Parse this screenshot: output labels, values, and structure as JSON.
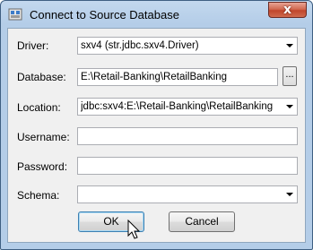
{
  "window": {
    "title": "Connect to Source Database"
  },
  "icons": {
    "app": "database-connect-icon",
    "close": "close-icon",
    "dropdown": "chevron-down-icon",
    "cursor": "mouse-pointer-icon"
  },
  "form": {
    "driver": {
      "label": "Driver:",
      "value": "sxv4  (str.jdbc.sxv4.Driver)"
    },
    "database": {
      "label": "Database:",
      "value": "E:\\Retail-Banking\\RetailBanking",
      "browse_label": "..."
    },
    "location": {
      "label": "Location:",
      "value": "jdbc:sxv4:E:\\Retail-Banking\\RetailBanking"
    },
    "username": {
      "label": "Username:",
      "value": ""
    },
    "password": {
      "label": "Password:",
      "value": ""
    },
    "schema": {
      "label": "Schema:",
      "value": ""
    }
  },
  "buttons": {
    "ok": "OK",
    "cancel": "Cancel",
    "close": "x"
  }
}
